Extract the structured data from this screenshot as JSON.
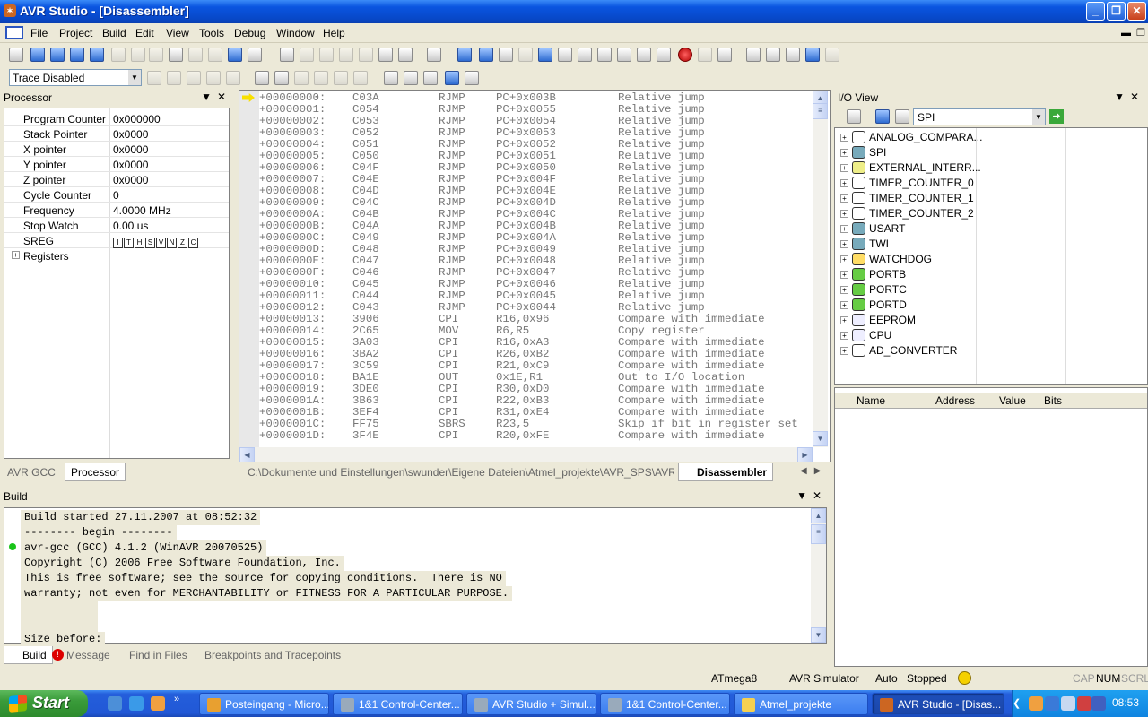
{
  "window": {
    "title": "AVR Studio - [Disassembler]"
  },
  "menu": [
    "File",
    "Project",
    "Build",
    "Edit",
    "View",
    "Tools",
    "Debug",
    "Window",
    "Help"
  ],
  "toolbar2": {
    "trace_combo": "Trace Disabled"
  },
  "processor": {
    "title": "Processor",
    "rows": [
      {
        "name": "Program Counter",
        "value": "0x000000"
      },
      {
        "name": "Stack Pointer",
        "value": "0x0000"
      },
      {
        "name": "X pointer",
        "value": "0x0000"
      },
      {
        "name": "Y pointer",
        "value": "0x0000"
      },
      {
        "name": "Z pointer",
        "value": "0x0000"
      },
      {
        "name": "Cycle Counter",
        "value": "0"
      },
      {
        "name": "Frequency",
        "value": "4.0000 MHz"
      },
      {
        "name": "Stop Watch",
        "value": "0.00 us"
      },
      {
        "name": "SREG",
        "value": ""
      },
      {
        "name": "Registers",
        "value": ""
      }
    ],
    "sreg_bits": [
      "I",
      "T",
      "H",
      "S",
      "V",
      "N",
      "Z",
      "C"
    ],
    "tabs": [
      "AVR GCC",
      "Processor"
    ]
  },
  "disassembler": {
    "lines": [
      [
        "+00000000:",
        "C03A",
        "RJMP",
        "PC+0x003B",
        "Relative jump"
      ],
      [
        "+00000001:",
        "C054",
        "RJMP",
        "PC+0x0055",
        "Relative jump"
      ],
      [
        "+00000002:",
        "C053",
        "RJMP",
        "PC+0x0054",
        "Relative jump"
      ],
      [
        "+00000003:",
        "C052",
        "RJMP",
        "PC+0x0053",
        "Relative jump"
      ],
      [
        "+00000004:",
        "C051",
        "RJMP",
        "PC+0x0052",
        "Relative jump"
      ],
      [
        "+00000005:",
        "C050",
        "RJMP",
        "PC+0x0051",
        "Relative jump"
      ],
      [
        "+00000006:",
        "C04F",
        "RJMP",
        "PC+0x0050",
        "Relative jump"
      ],
      [
        "+00000007:",
        "C04E",
        "RJMP",
        "PC+0x004F",
        "Relative jump"
      ],
      [
        "+00000008:",
        "C04D",
        "RJMP",
        "PC+0x004E",
        "Relative jump"
      ],
      [
        "+00000009:",
        "C04C",
        "RJMP",
        "PC+0x004D",
        "Relative jump"
      ],
      [
        "+0000000A:",
        "C04B",
        "RJMP",
        "PC+0x004C",
        "Relative jump"
      ],
      [
        "+0000000B:",
        "C04A",
        "RJMP",
        "PC+0x004B",
        "Relative jump"
      ],
      [
        "+0000000C:",
        "C049",
        "RJMP",
        "PC+0x004A",
        "Relative jump"
      ],
      [
        "+0000000D:",
        "C048",
        "RJMP",
        "PC+0x0049",
        "Relative jump"
      ],
      [
        "+0000000E:",
        "C047",
        "RJMP",
        "PC+0x0048",
        "Relative jump"
      ],
      [
        "+0000000F:",
        "C046",
        "RJMP",
        "PC+0x0047",
        "Relative jump"
      ],
      [
        "+00000010:",
        "C045",
        "RJMP",
        "PC+0x0046",
        "Relative jump"
      ],
      [
        "+00000011:",
        "C044",
        "RJMP",
        "PC+0x0045",
        "Relative jump"
      ],
      [
        "+00000012:",
        "C043",
        "RJMP",
        "PC+0x0044",
        "Relative jump"
      ],
      [
        "+00000013:",
        "3906",
        "CPI",
        "R16,0x96",
        "Compare with immediate"
      ],
      [
        "+00000014:",
        "2C65",
        "MOV",
        "R6,R5",
        "Copy register"
      ],
      [
        "+00000015:",
        "3A03",
        "CPI",
        "R16,0xA3",
        "Compare with immediate"
      ],
      [
        "+00000016:",
        "3BA2",
        "CPI",
        "R26,0xB2",
        "Compare with immediate"
      ],
      [
        "+00000017:",
        "3C59",
        "CPI",
        "R21,0xC9",
        "Compare with immediate"
      ],
      [
        "+00000018:",
        "BA1E",
        "OUT",
        "0x1E,R1",
        "Out to I/O location"
      ],
      [
        "+00000019:",
        "3DE0",
        "CPI",
        "R30,0xD0",
        "Compare with immediate"
      ],
      [
        "+0000001A:",
        "3B63",
        "CPI",
        "R22,0xB3",
        "Compare with immediate"
      ],
      [
        "+0000001B:",
        "3EF4",
        "CPI",
        "R31,0xE4",
        "Compare with immediate"
      ],
      [
        "+0000001C:",
        "FF75",
        "SBRS",
        "R23,5",
        "Skip if bit in register set"
      ],
      [
        "+0000001D:",
        "3F4E",
        "CPI",
        "R20,0xFE",
        "Compare with immediate"
      ]
    ],
    "tabs": {
      "file": "C:\\Dokumente und Einstellungen\\swunder\\Eigene Dateien\\Atmel_projekte\\AVR_SPS\\AVR_SPS.c",
      "active": "Disassembler"
    }
  },
  "io": {
    "title": "I/O View",
    "filter": "SPI",
    "items": [
      "ANALOG_COMPARA...",
      "SPI",
      "EXTERNAL_INTERR...",
      "TIMER_COUNTER_0",
      "TIMER_COUNTER_1",
      "TIMER_COUNTER_2",
      "USART",
      "TWI",
      "WATCHDOG",
      "PORTB",
      "PORTC",
      "PORTD",
      "EEPROM",
      "CPU",
      "AD_CONVERTER"
    ],
    "columns": [
      "Name",
      "Address",
      "Value",
      "Bits"
    ]
  },
  "build": {
    "title": "Build",
    "lines": [
      "Build started 27.11.2007 at 08:52:32",
      "-------- begin --------",
      "avr-gcc (GCC) 4.1.2 (WinAVR 20070525)",
      "Copyright (C) 2006 Free Software Foundation, Inc.",
      "This is free software; see the source for copying conditions.  There is NO",
      "warranty; not even for MERCHANTABILITY or FITNESS FOR A PARTICULAR PURPOSE.",
      "",
      "",
      "Size before:"
    ],
    "tabs": [
      "Build",
      "Message",
      "Find in Files",
      "Breakpoints and Tracepoints"
    ]
  },
  "status": {
    "device": "ATmega8",
    "platform": "AVR Simulator",
    "mode": "Auto",
    "state": "Stopped",
    "cap": "CAP",
    "num": "NUM",
    "scrl": "SCRL"
  },
  "taskbar": {
    "start": "Start",
    "tasks": [
      "Posteingang - Micro...",
      "1&1 Control-Center...",
      "AVR Studio + Simul...",
      "1&1 Control-Center...",
      "Atmel_projekte",
      "AVR Studio - [Disas..."
    ],
    "clock": "08:53"
  }
}
